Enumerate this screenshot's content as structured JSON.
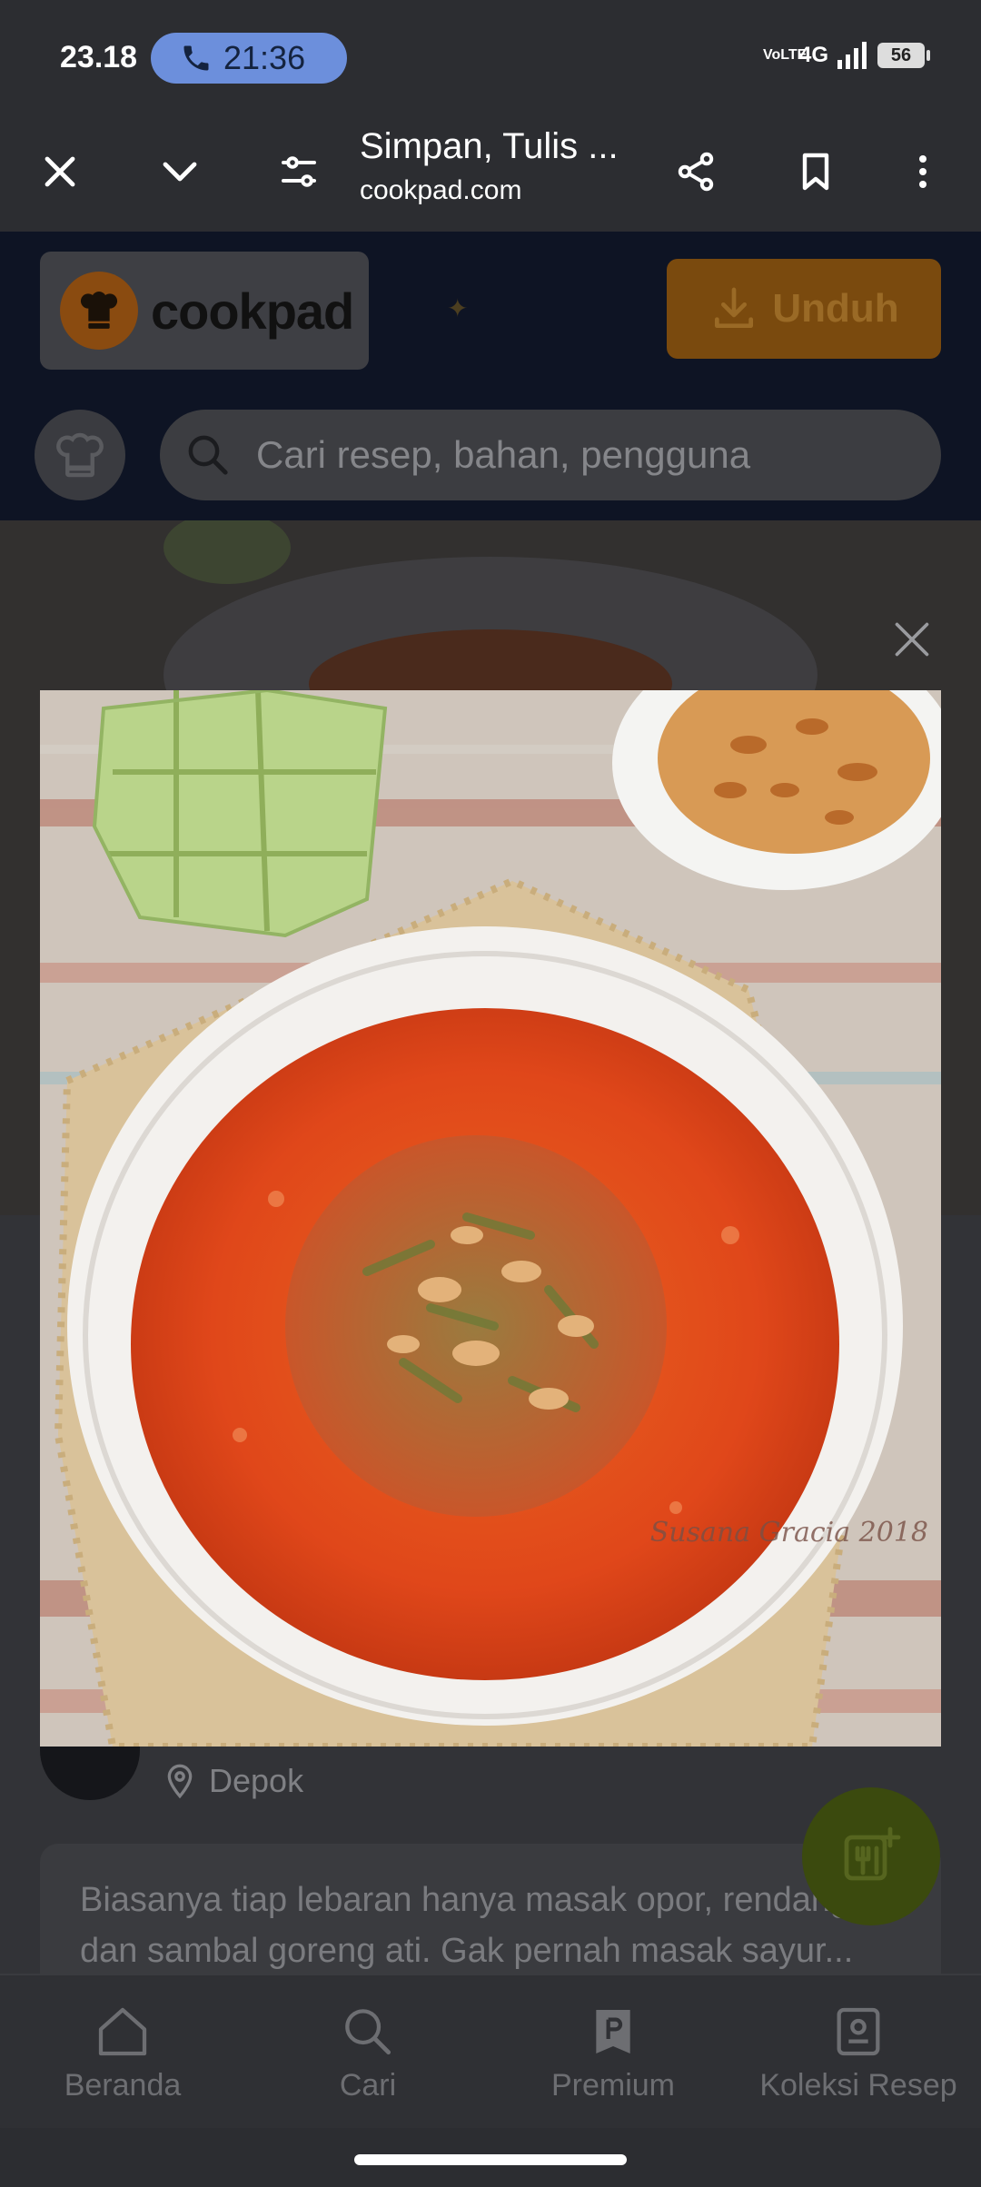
{
  "status_bar": {
    "time": "23.18",
    "call_timer": "21:36",
    "network": "4G",
    "volte": "VoLTE",
    "battery": "56"
  },
  "browser": {
    "page_title": "Simpan, Tulis ...",
    "domain": "cookpad.com"
  },
  "cookpad_header": {
    "logo_text": "cookpad",
    "download_label": "Unduh",
    "search_placeholder": "Cari resep, bahan, pengguna"
  },
  "recipe": {
    "author_location": "Depok",
    "description": "Biasanya tiap lebaran hanya masak opor, rendang dan sambal goreng ati. Gak pernah masak sayur...",
    "image_watermark": "Susana Gracia 2018"
  },
  "bottom_nav": {
    "items": [
      {
        "label": "Beranda",
        "icon": "home-icon"
      },
      {
        "label": "Cari",
        "icon": "search-icon"
      },
      {
        "label": "Premium",
        "icon": "premium-icon"
      },
      {
        "label": "Koleksi Resep",
        "icon": "collection-icon"
      }
    ]
  },
  "colors": {
    "call_pill": "#6c8fdc",
    "overlay_background": "#2f3034",
    "download_button": "#7a4a0e",
    "fab": "#3b4a0e"
  }
}
